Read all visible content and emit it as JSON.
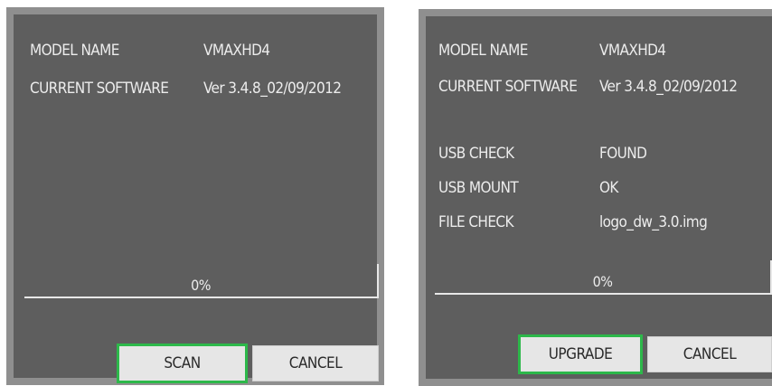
{
  "left_panel": {
    "model_name_label": "MODEL NAME",
    "model_name_value": "VMAXHD4",
    "current_software_label": "CURRENT SOFTWARE",
    "current_software_value": "Ver 3.4.8_02/09/2012",
    "progress_text": "0%",
    "progress_value": 0,
    "primary_button": "SCAN",
    "cancel_button": "CANCEL"
  },
  "right_panel": {
    "model_name_label": "MODEL NAME",
    "model_name_value": "VMAXHD4",
    "current_software_label": "CURRENT SOFTWARE",
    "current_software_value": "Ver 3.4.8_02/09/2012",
    "usb_check_label": "USB CHECK",
    "usb_check_value": "FOUND",
    "usb_mount_label": "USB MOUNT",
    "usb_mount_value": "OK",
    "file_check_label": "FILE CHECK",
    "file_check_value": "logo_dw_3.0.img",
    "progress_text": "0%",
    "progress_value": 0,
    "primary_button": "UPGRADE",
    "cancel_button": "CANCEL"
  },
  "colors": {
    "panel_bg": "#5e5e5e",
    "panel_border": "#8f8f8f",
    "focus_green": "#2db84a",
    "button_bg": "#e6e6e6"
  }
}
